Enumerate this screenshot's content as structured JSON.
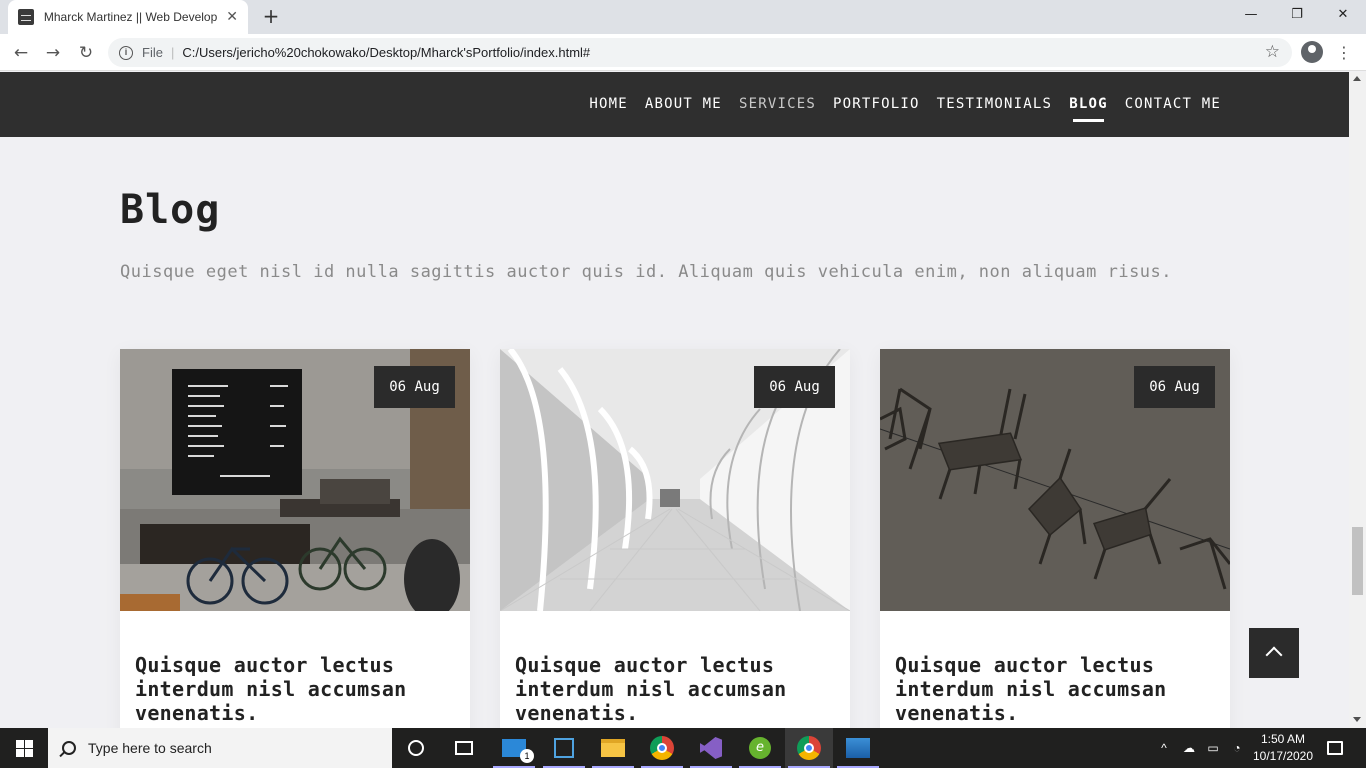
{
  "browser": {
    "tab_title": "Mharck Martinez || Web Develop",
    "tab_close": "✕",
    "new_tab": "+",
    "minimize": "—",
    "restore": "❐",
    "close": "✕",
    "back": "←",
    "forward": "→",
    "reload": "↻",
    "scheme_label": "File",
    "url": "C:/Users/jericho%20chokowako/Desktop/Mharck'sPortfolio/index.html#",
    "bookmark_star": "☆",
    "menu": "⋮"
  },
  "nav": {
    "links": [
      {
        "label": "HOME"
      },
      {
        "label": "ABOUT ME"
      },
      {
        "label": "SERVICES"
      },
      {
        "label": "PORTFOLIO"
      },
      {
        "label": "TESTIMONIALS"
      },
      {
        "label": "BLOG"
      },
      {
        "label": "CONTACT ME"
      }
    ],
    "active": "BLOG"
  },
  "blog": {
    "title": "Blog",
    "subtitle": "Quisque eget nisl id nulla sagittis auctor quis id. Aliquam quis vehicula enim, non aliquam risus.",
    "cards": [
      {
        "date": "06 Aug",
        "title": "Quisque auctor lectus interdum nisl accumsan venenatis.",
        "image": "cafe-with-bicycles"
      },
      {
        "date": "06 Aug",
        "title": "Quisque auctor lectus interdum nisl accumsan venenatis.",
        "image": "white-arched-corridor"
      },
      {
        "date": "06 Aug",
        "title": "Quisque auctor lectus interdum nisl accumsan venenatis.",
        "image": "floating-chairs"
      }
    ]
  },
  "taskbar": {
    "search_placeholder": "Type here to search",
    "mail_badge": "1",
    "time": "1:50 AM",
    "date": "10/17/2020"
  },
  "colors": {
    "nav_bg": "#2f2f2f",
    "page_bg": "#f0f0f3",
    "date_badge_bg": "#2b2b2b",
    "taskbar_bg": "#20201f"
  }
}
